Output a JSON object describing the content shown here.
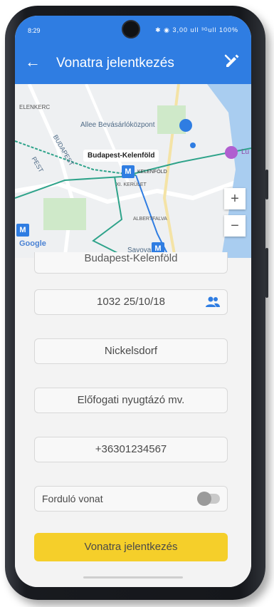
{
  "status_bar": {
    "time": "8:29",
    "icons_text": "✱ ◉ 3,00 ull ³ᴳull 100%"
  },
  "app_bar": {
    "title": "Vonatra jelentkezés",
    "back_icon": "arrow-left-icon",
    "action_icon": "edit-pen-icon"
  },
  "map": {
    "labels": {
      "mall": "Allee Bevásárlóközpont",
      "budapest": "BUDAPEST",
      "pest": "PEST",
      "kelenfold_small": "KELENFÖLD",
      "kerulet": "XI. KERÜLET",
      "albertfalva": "ALBERTFALVA",
      "savoya": "Savoya P",
      "top_left": "ELENKERC",
      "right_edge": "Lu"
    },
    "selected_place": "Budapest-Kelenföld",
    "attribution": "Google",
    "zoom_in": "+",
    "zoom_out": "−",
    "metro_badge": "M",
    "colors": {
      "metro": "#2f7de2",
      "railway": "#2ea38a",
      "park": "#cfe9c9",
      "water": "#a9cdf0"
    }
  },
  "form": {
    "departure_partial": "Budapest-Kelenföld",
    "train_date": "1032 25/10/18",
    "destination": "Nickelsdorf",
    "track": "Előfogati nyugtázó mv.",
    "phone": "+36301234567",
    "turning_train_label": "Forduló vonat",
    "turning_train_on": false,
    "submit_label": "Vonatra jelentkezés"
  },
  "colors": {
    "primary": "#2f7de2",
    "accent": "#f5cf2a"
  }
}
